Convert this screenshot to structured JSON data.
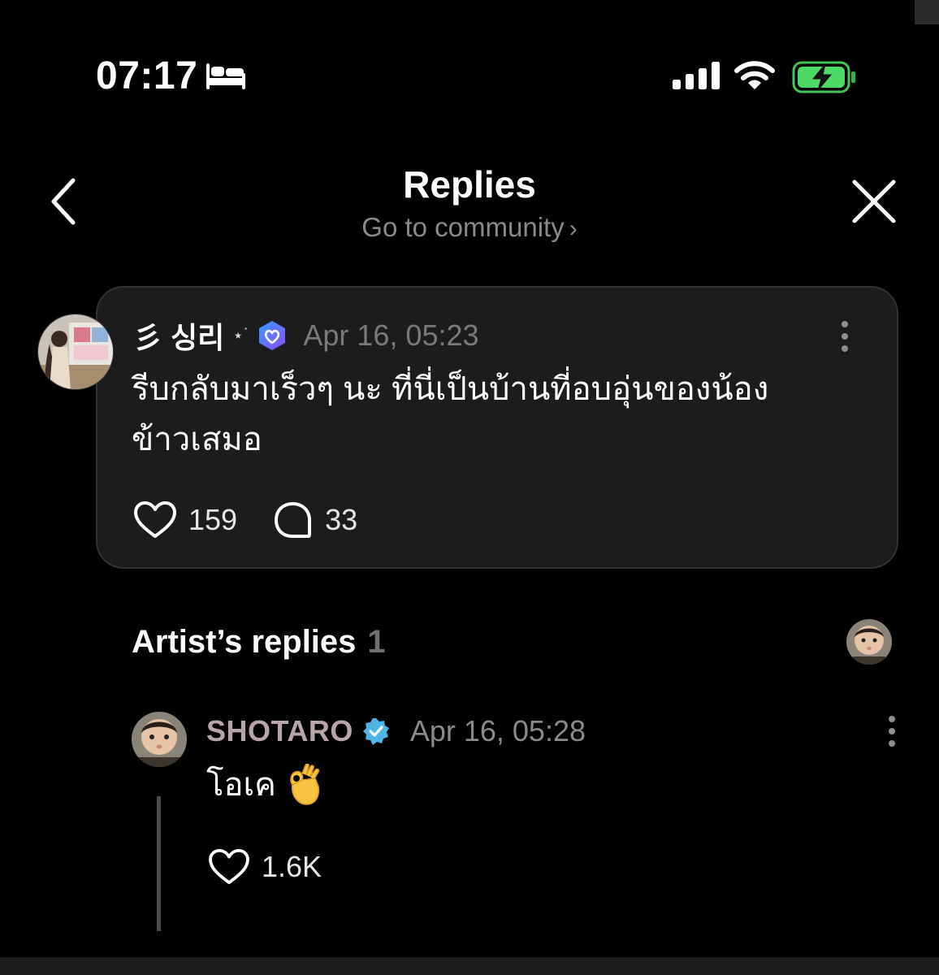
{
  "status_bar": {
    "time": "07:17",
    "sleep_icon": "bed-icon",
    "signal_icon": "cellular-signal-icon",
    "wifi_icon": "wifi-icon",
    "battery_icon": "battery-charging-icon",
    "battery_color": "#4cd964"
  },
  "header": {
    "title": "Replies",
    "community_link": "Go to community",
    "community_chevron": "›",
    "back_icon": "chevron-left-icon",
    "close_icon": "close-icon"
  },
  "post": {
    "author": "彡 싱리",
    "author_decoration": "⋆˙",
    "badge_icon": "fan-heart-badge-icon",
    "badge_color": "#6b5cff",
    "timestamp": "Apr 16, 05:23",
    "text_line1": "รีบกลับมาเร็วๆ นะ ที่นี่เป็นบ้านที่อบอุ่นของน้อง",
    "text_line2": "ข้าวเสมอ",
    "likes": "159",
    "comments": "33",
    "more_icon": "more-vertical-icon"
  },
  "artist_replies": {
    "heading": "Artist’s replies",
    "count": "1"
  },
  "reply": {
    "author": "SHOTARO",
    "author_color": "#b8a5a7",
    "verified_color": "#4fb4e6",
    "timestamp": "Apr 16, 05:28",
    "text": "โอเค",
    "emoji": "👌",
    "likes": "1.6K",
    "more_icon": "more-vertical-icon"
  }
}
